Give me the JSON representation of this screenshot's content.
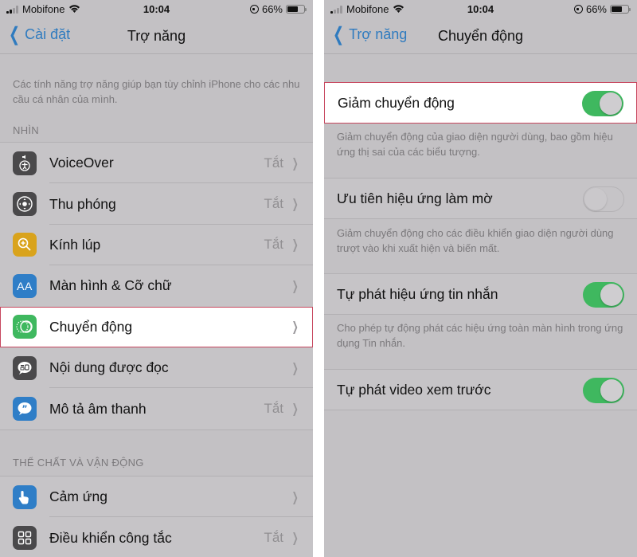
{
  "left": {
    "status": {
      "carrier": "Mobifone",
      "time": "10:04",
      "battery": "66%",
      "battery_level": 0.66
    },
    "nav": {
      "back_label": "Cài đặt",
      "title": "Trợ năng"
    },
    "intro": "Các tính năng trợ năng giúp bạn tùy chỉnh iPhone cho các nhu cầu cá nhân của mình.",
    "sections": [
      {
        "header": "NHÌN",
        "items": [
          {
            "label": "VoiceOver",
            "value": "Tắt",
            "icon": "voiceover-icon",
            "color": "#4a494b"
          },
          {
            "label": "Thu phóng",
            "value": "Tắt",
            "icon": "zoom-icon",
            "color": "#4a494b"
          },
          {
            "label": "Kính lúp",
            "value": "Tắt",
            "icon": "magnifier-icon",
            "color": "#d9a31c"
          },
          {
            "label": "Màn hình & Cỡ chữ",
            "value": "",
            "icon": "display-text-size-icon",
            "color": "#2f7ec7"
          },
          {
            "label": "Chuyển động",
            "value": "",
            "icon": "motion-icon",
            "color": "#3fb85f",
            "highlighted": true
          },
          {
            "label": "Nội dung được đọc",
            "value": "",
            "icon": "spoken-content-icon",
            "color": "#4a494b"
          },
          {
            "label": "Mô tả âm thanh",
            "value": "Tắt",
            "icon": "audio-descriptions-icon",
            "color": "#2f7ec7"
          }
        ]
      },
      {
        "header": "THỂ CHẤT VÀ VẬN ĐỘNG",
        "items": [
          {
            "label": "Cảm ứng",
            "value": "",
            "icon": "touch-icon",
            "color": "#2f7ec7"
          },
          {
            "label": "Điều khiển công tắc",
            "value": "Tắt",
            "icon": "switch-control-icon",
            "color": "#4a494b"
          }
        ]
      }
    ]
  },
  "right": {
    "status": {
      "carrier": "Mobifone",
      "time": "10:04",
      "battery": "66%",
      "battery_level": 0.66
    },
    "nav": {
      "back_label": "Trợ năng",
      "title": "Chuyển động"
    },
    "settings": [
      {
        "label": "Giảm chuyển động",
        "on": true,
        "highlighted": true,
        "footer": "Giảm chuyển động của giao diện người dùng, bao gồm hiệu ứng thị sai của các biểu tượng."
      },
      {
        "label": "Ưu tiên hiệu ứng làm mờ",
        "on": false,
        "footer": "Giảm chuyển động cho các điều khiển giao diện người dùng trượt vào khi xuất hiện và biến mất."
      },
      {
        "label": "Tự phát hiệu ứng tin nhắn",
        "on": true,
        "footer": "Cho phép tự động phát các hiệu ứng toàn màn hình trong ứng dụng Tin nhắn."
      },
      {
        "label": "Tự phát video xem trước",
        "on": true,
        "footer": ""
      }
    ]
  },
  "colors": {
    "accent": "#2f7bbf",
    "toggle_on": "#3fb85f",
    "highlight_border": "#c7465e"
  }
}
